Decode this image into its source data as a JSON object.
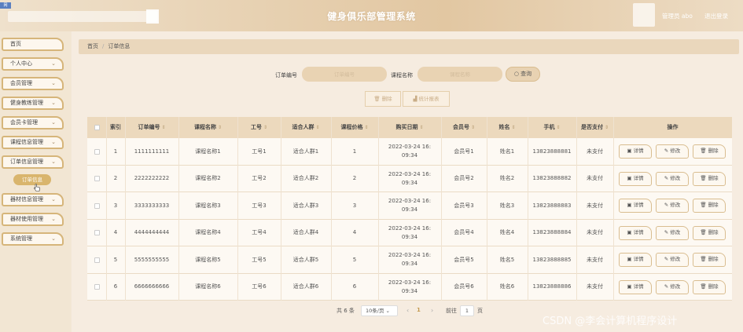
{
  "header": {
    "logo": "网",
    "title": "健身俱乐部管理系统",
    "admin": "管理员 abo",
    "logout": "退出登录"
  },
  "sidebar": {
    "items": [
      {
        "label": "首页",
        "chev": ""
      },
      {
        "label": "个人中心",
        "chev": "⌄"
      },
      {
        "label": "会员管理",
        "chev": "⌄"
      },
      {
        "label": "健身教练管理",
        "chev": "⌄"
      },
      {
        "label": "会员卡管理",
        "chev": "⌄"
      },
      {
        "label": "课程信息管理",
        "chev": "⌄"
      },
      {
        "label": "订单信息管理",
        "chev": "⌄"
      },
      {
        "label": "器材信息管理",
        "chev": "⌄"
      },
      {
        "label": "器材使用管理",
        "chev": "⌄"
      },
      {
        "label": "系统管理",
        "chev": "⌄"
      }
    ],
    "submenu": "订单信息"
  },
  "breadcrumb": {
    "home": "首页",
    "sep": "/",
    "current": "订单信息"
  },
  "search": {
    "order_label": "订单编号",
    "order_placeholder": "订单编号",
    "course_label": "课程名称",
    "course_placeholder": "课程名称",
    "query": "查询",
    "query_icon": "○"
  },
  "actions": {
    "delete": "删除",
    "delete_icon": "🗑",
    "stats": "统计报表",
    "stats_icon": "▟"
  },
  "table": {
    "headers": [
      "",
      "索引",
      "订单编号",
      "课程名称",
      "工号",
      "适合人群",
      "课程价格",
      "购买日期",
      "会员号",
      "姓名",
      "手机",
      "是否支付",
      "操作"
    ],
    "rows": [
      {
        "idx": "1",
        "order": "1111111111",
        "course": "课程名称1",
        "worker": "工号1",
        "crowd": "适合人群1",
        "price": "1",
        "date1": "2022-03-24 16:",
        "date2": "09:34",
        "member": "会员号1",
        "name": "姓名1",
        "phone": "13823888881",
        "paid": "未支付"
      },
      {
        "idx": "2",
        "order": "2222222222",
        "course": "课程名称2",
        "worker": "工号2",
        "crowd": "适合人群2",
        "price": "2",
        "date1": "2022-03-24 16:",
        "date2": "09:34",
        "member": "会员号2",
        "name": "姓名2",
        "phone": "13823888882",
        "paid": "未支付"
      },
      {
        "idx": "3",
        "order": "3333333333",
        "course": "课程名称3",
        "worker": "工号3",
        "crowd": "适合人群3",
        "price": "3",
        "date1": "2022-03-24 16:",
        "date2": "09:34",
        "member": "会员号3",
        "name": "姓名3",
        "phone": "13823888883",
        "paid": "未支付"
      },
      {
        "idx": "4",
        "order": "4444444444",
        "course": "课程名称4",
        "worker": "工号4",
        "crowd": "适合人群4",
        "price": "4",
        "date1": "2022-03-24 16:",
        "date2": "09:34",
        "member": "会员号4",
        "name": "姓名4",
        "phone": "13823888884",
        "paid": "未支付"
      },
      {
        "idx": "5",
        "order": "5555555555",
        "course": "课程名称5",
        "worker": "工号5",
        "crowd": "适合人群5",
        "price": "5",
        "date1": "2022-03-24 16:",
        "date2": "09:34",
        "member": "会员号5",
        "name": "姓名5",
        "phone": "13823888885",
        "paid": "未支付"
      },
      {
        "idx": "6",
        "order": "6666666666",
        "course": "课程名称6",
        "worker": "工号6",
        "crowd": "适合人群6",
        "price": "6",
        "date1": "2022-03-24 16:",
        "date2": "09:34",
        "member": "会员号6",
        "name": "姓名6",
        "phone": "13823888886",
        "paid": "未支付"
      }
    ],
    "ops": {
      "detail": "详情",
      "edit": "修改",
      "delete": "删除",
      "detail_icon": "▣",
      "edit_icon": "✎",
      "delete_icon": "🗑"
    }
  },
  "pager": {
    "total": "共 6 条",
    "size": "10条/页",
    "size_chev": "⌄",
    "prev": "‹",
    "current": "1",
    "next": "›",
    "goto": "前往",
    "goto_value": "1",
    "page": "页"
  },
  "watermark": "CSDN @李会计算机程序设计"
}
